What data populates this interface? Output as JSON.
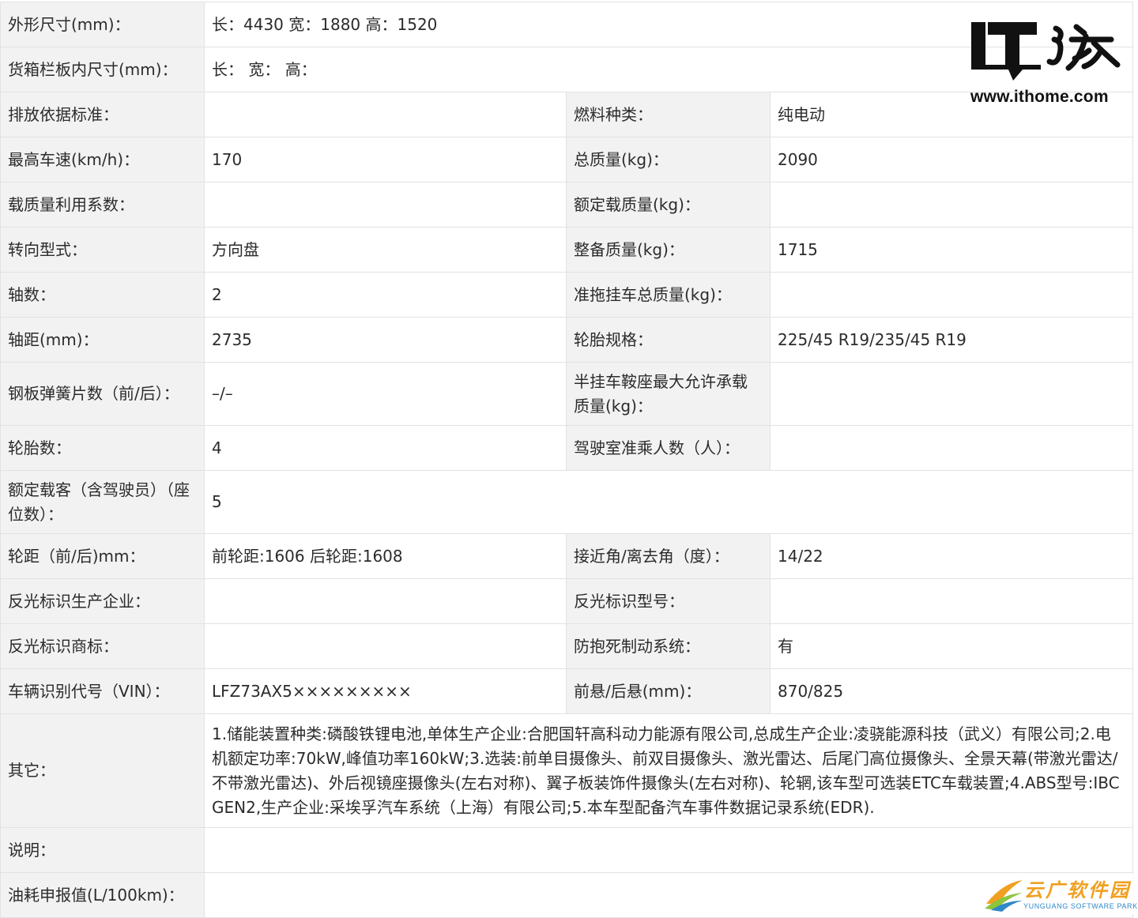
{
  "rows": [
    {
      "label": "外形尺寸(mm)：",
      "value": "长：4430 宽：1880 高：1520"
    },
    {
      "label": "货箱栏板内尺寸(mm)：",
      "value": "长：  宽：  高："
    },
    {
      "label": "排放依据标准：",
      "value": "",
      "label2": "燃料种类：",
      "value2": "纯电动"
    },
    {
      "label": "最高车速(km/h)：",
      "value": "170",
      "label2": "总质量(kg)：",
      "value2": "2090"
    },
    {
      "label": "载质量利用系数：",
      "value": "",
      "label2": "额定载质量(kg)：",
      "value2": ""
    },
    {
      "label": "转向型式：",
      "value": "方向盘",
      "label2": "整备质量(kg)：",
      "value2": "1715"
    },
    {
      "label": "轴数：",
      "value": "2",
      "label2": "准拖挂车总质量(kg)：",
      "value2": ""
    },
    {
      "label": "轴距(mm)：",
      "value": "2735",
      "label2": "轮胎规格：",
      "value2": "225/45 R19/235/45 R19"
    },
    {
      "label": "钢板弹簧片数（前/后）：",
      "value": "–/–",
      "label2": "半挂车鞍座最大允许承载质量(kg)：",
      "value2": ""
    },
    {
      "label": "轮胎数：",
      "value": "4",
      "label2": "驾驶室准乘人数（人）：",
      "value2": ""
    },
    {
      "label": "额定载客（含驾驶员）（座位数）：",
      "value": "5"
    },
    {
      "label": "轮距（前/后)mm：",
      "value": "前轮距:1606 后轮距:1608",
      "label2": "接近角/离去角（度）：",
      "value2": "14/22"
    },
    {
      "label": "反光标识生产企业：",
      "value": "",
      "label2": "反光标识型号：",
      "value2": ""
    },
    {
      "label": "反光标识商标：",
      "value": "",
      "label2": "防抱死制动系统：",
      "value2": "有"
    },
    {
      "label": "车辆识别代号（VIN）：",
      "value": "LFZ73AX5×××××××××",
      "label2": "前悬/后悬(mm)：",
      "value2": "870/825"
    },
    {
      "label": "其它：",
      "value": "1.储能装置种类:磷酸铁锂电池,单体生产企业:合肥国轩高科动力能源有限公司,总成生产企业:凌骁能源科技（武义）有限公司;2.电机额定功率:70kW,峰值功率160kW;3.选装:前单目摄像头、前双目摄像头、激光雷达、后尾门高位摄像头、全景天幕(带激光雷达/不带激光雷达)、外后视镜座摄像头(左右对称)、翼子板装饰件摄像头(左右对称)、轮辋,该车型可选装ETC车载装置;4.ABS型号:IBC GEN2,生产企业:采埃孚汽车系统（上海）有限公司;5.本车型配备汽车事件数据记录系统(EDR)."
    },
    {
      "label": "说明：",
      "value": ""
    },
    {
      "label": "油耗申报值(L/100km)：",
      "value": ""
    }
  ],
  "logo": {
    "url": "www.ithome.com",
    "icon": "ithome-logo-icon"
  },
  "watermark": {
    "title": "云广软件园",
    "subtitle": "YUNGUANG SOFTWARE PARK",
    "icon": "yunguang-logo-icon"
  },
  "colors": {
    "label_bg": "#f2f2f2",
    "border": "#e2e2e2",
    "text": "#2b2b2b",
    "watermark_orange": "#f0a020",
    "watermark_blue": "#2f88c8"
  }
}
